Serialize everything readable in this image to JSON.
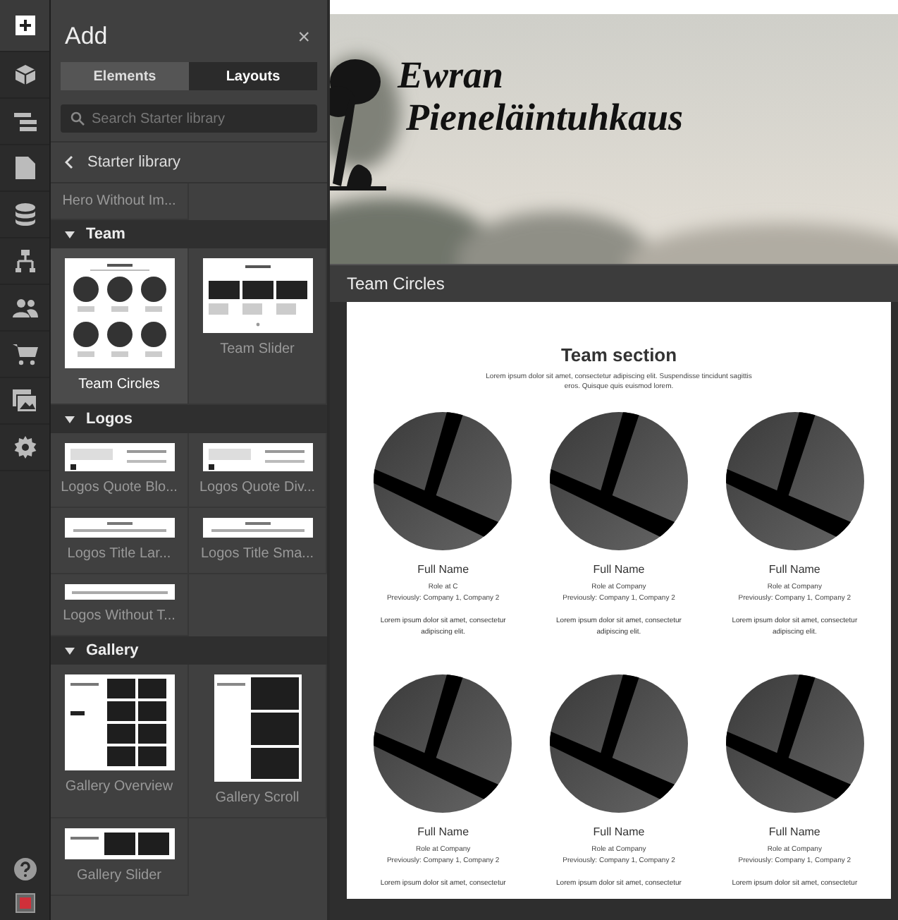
{
  "rail": {
    "items": [
      {
        "kind": "add",
        "selected": true
      },
      {
        "kind": "box",
        "selected": false
      },
      {
        "kind": "navigator",
        "selected": false
      },
      {
        "kind": "page",
        "selected": false
      },
      {
        "kind": "database",
        "selected": false
      },
      {
        "kind": "logic",
        "selected": false
      },
      {
        "kind": "users",
        "selected": false
      },
      {
        "kind": "cart",
        "selected": false
      },
      {
        "kind": "assets",
        "selected": false
      },
      {
        "kind": "settings",
        "selected": false
      }
    ],
    "bottom": [
      {
        "kind": "help"
      },
      {
        "kind": "record"
      }
    ]
  },
  "panel": {
    "title": "Add",
    "close": "×",
    "tabs": [
      {
        "label": "Elements",
        "selected": false
      },
      {
        "label": "Layouts",
        "selected": true
      }
    ],
    "search": {
      "placeholder": "Search Starter library"
    },
    "breadcrumb": "Starter library",
    "groups": [
      {
        "items": [
          {
            "label": "Hero Without Im...",
            "kind": "none",
            "selected": false
          }
        ]
      },
      {
        "title": "Team",
        "expanded": true,
        "items": [
          {
            "label": "Team Circles",
            "kind": "circles",
            "selected": true
          },
          {
            "label": "Team Slider",
            "kind": "slider",
            "selected": false
          }
        ]
      },
      {
        "title": "Logos",
        "expanded": true,
        "items": [
          {
            "label": "Logos Quote Blo...",
            "kind": "quote",
            "selected": false
          },
          {
            "label": "Logos Quote Div...",
            "kind": "quote",
            "selected": false
          },
          {
            "label": "Logos Title Lar...",
            "kind": "bar",
            "selected": false
          },
          {
            "label": "Logos Title Sma...",
            "kind": "bar",
            "selected": false
          },
          {
            "label": "Logos Without T...",
            "kind": "strip",
            "selected": false
          }
        ]
      },
      {
        "title": "Gallery",
        "expanded": true,
        "items": [
          {
            "label": "Gallery Overview",
            "kind": "gallery-grid",
            "selected": false
          },
          {
            "label": "Gallery Scroll",
            "kind": "gallery-scroll",
            "selected": false
          },
          {
            "label": "Gallery Slider",
            "kind": "gallery-slider",
            "selected": false
          }
        ]
      }
    ]
  },
  "canvas": {
    "hero": {
      "kind": "picture",
      "logo_lines": [
        "Ewran",
        "Pieneläintuhkaus"
      ]
    },
    "preview": {
      "title": "Team Circles",
      "heading": "Team section",
      "intro": "Lorem ipsum dolor sit amet, consectetur adipiscing elit. Suspendisse tincidunt sagittis eros. Quisque quis euismod lorem.",
      "members": [
        {
          "name": "Full Name",
          "role": "Role at C",
          "previously": "Previously: Company 1, Company 2",
          "bio": "Lorem ipsum dolor sit amet, consectetur adipiscing elit."
        },
        {
          "name": "Full Name",
          "role": "Role at Company",
          "previously": "Previously: Company 1, Company 2",
          "bio": "Lorem ipsum dolor sit amet, consectetur adipiscing elit."
        },
        {
          "name": "Full Name",
          "role": "Role at Company",
          "previously": "Previously: Company 1, Company 2",
          "bio": "Lorem ipsum dolor sit amet, consectetur adipiscing elit."
        },
        {
          "name": "Full Name",
          "role": "Role at Company",
          "previously": "Previously: Company 1, Company 2",
          "bio": "Lorem ipsum dolor sit amet, consectetur"
        },
        {
          "name": "Full Name",
          "role": "Role at Company",
          "previously": "Previously: Company 1, Company 2",
          "bio": "Lorem ipsum dolor sit amet, consectetur"
        },
        {
          "name": "Full Name",
          "role": "Role at Company",
          "previously": "Previously: Company 1, Company 2",
          "bio": "Lorem ipsum dolor sit amet, consectetur"
        }
      ]
    }
  }
}
